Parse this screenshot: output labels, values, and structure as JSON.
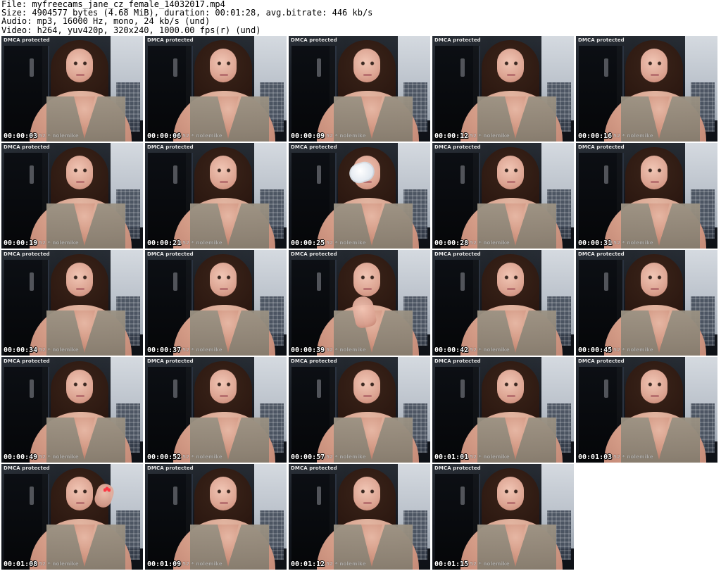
{
  "header": {
    "lines": [
      "File: myfreecams_jane_cz_female_14032017.mp4",
      "Size: 4904577 bytes (4.68 MiB), duration: 00:01:28, avg.bitrate: 446 kb/s",
      "Audio: mp3, 16000 Hz, mono, 24 kb/s (und)",
      "Video: h264, yuv420p, 320x240, 1000.00 fps(r) (und)"
    ]
  },
  "overlays": {
    "dmca": "DMCA protected",
    "watermark_text": "152 * nolemike"
  },
  "thumbnails": [
    {
      "timestamp": "00:00:03",
      "variant": "base"
    },
    {
      "timestamp": "00:00:06",
      "variant": "base"
    },
    {
      "timestamp": "00:00:09",
      "variant": "base"
    },
    {
      "timestamp": "00:00:12",
      "variant": "base"
    },
    {
      "timestamp": "00:00:16",
      "variant": "base"
    },
    {
      "timestamp": "00:00:19",
      "variant": "base"
    },
    {
      "timestamp": "00:00:21",
      "variant": "base"
    },
    {
      "timestamp": "00:00:25",
      "variant": "cup"
    },
    {
      "timestamp": "00:00:28",
      "variant": "base"
    },
    {
      "timestamp": "00:00:31",
      "variant": "base"
    },
    {
      "timestamp": "00:00:34",
      "variant": "base"
    },
    {
      "timestamp": "00:00:37",
      "variant": "base"
    },
    {
      "timestamp": "00:00:39",
      "variant": "hand"
    },
    {
      "timestamp": "00:00:42",
      "variant": "base"
    },
    {
      "timestamp": "00:00:45",
      "variant": "base"
    },
    {
      "timestamp": "00:00:49",
      "variant": "base"
    },
    {
      "timestamp": "00:00:52",
      "variant": "base"
    },
    {
      "timestamp": "00:00:57",
      "variant": "base"
    },
    {
      "timestamp": "00:01:01",
      "variant": "base"
    },
    {
      "timestamp": "00:01:03",
      "variant": "base"
    },
    {
      "timestamp": "00:01:08",
      "variant": "hair-hand"
    },
    {
      "timestamp": "00:01:09",
      "variant": "base"
    },
    {
      "timestamp": "00:01:12",
      "variant": "base"
    },
    {
      "timestamp": "00:01:15",
      "variant": "base"
    }
  ]
}
